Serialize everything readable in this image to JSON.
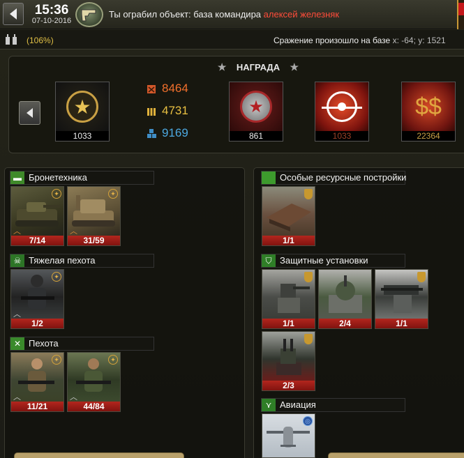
{
  "header": {
    "time": "15:36",
    "date": "07-10-2016",
    "message_prefix": "Ты ограбил объект: база командира",
    "commander": "алексей железняк"
  },
  "status": {
    "percent": "(106%)",
    "battle_text": "Сражение произошло на базе",
    "coords": "x: -64; y: 1521"
  },
  "reward": {
    "title": "НАГРАДА",
    "rank_value": "1033",
    "resources": [
      {
        "icon": "fuel-canister-icon",
        "value": "8464",
        "color": "#f2702c"
      },
      {
        "icon": "ammo-icon",
        "value": "4731",
        "color": "#e9c042"
      },
      {
        "icon": "metal-crates-icon",
        "value": "9169",
        "color": "#4ca8e0"
      }
    ],
    "medal_value": "861",
    "target_value": "1033",
    "money_value": "22364"
  },
  "left_sections": [
    {
      "title": "Бронетехника",
      "icon": "tank-icon",
      "units": [
        {
          "count": "7/14"
        },
        {
          "count": "31/59"
        }
      ]
    },
    {
      "title": "Тяжелая пехота",
      "icon": "skull-icon",
      "units": [
        {
          "count": "1/2"
        }
      ]
    },
    {
      "title": "Пехота",
      "icon": "crossed-rifles-icon",
      "units": [
        {
          "count": "11/21"
        },
        {
          "count": "44/84"
        }
      ]
    }
  ],
  "right_sections": [
    {
      "title": "Особые ресурсные постройки",
      "icon": "green-square-icon",
      "units": [
        {
          "count": "1/1"
        }
      ]
    },
    {
      "title": "Защитные установки",
      "icon": "shield-icon",
      "units": [
        {
          "count": "1/1"
        },
        {
          "count": "2/4"
        },
        {
          "count": "1/1"
        },
        {
          "count": "2/3"
        }
      ]
    },
    {
      "title": "Авиация",
      "icon": "wings-icon",
      "units": []
    }
  ]
}
